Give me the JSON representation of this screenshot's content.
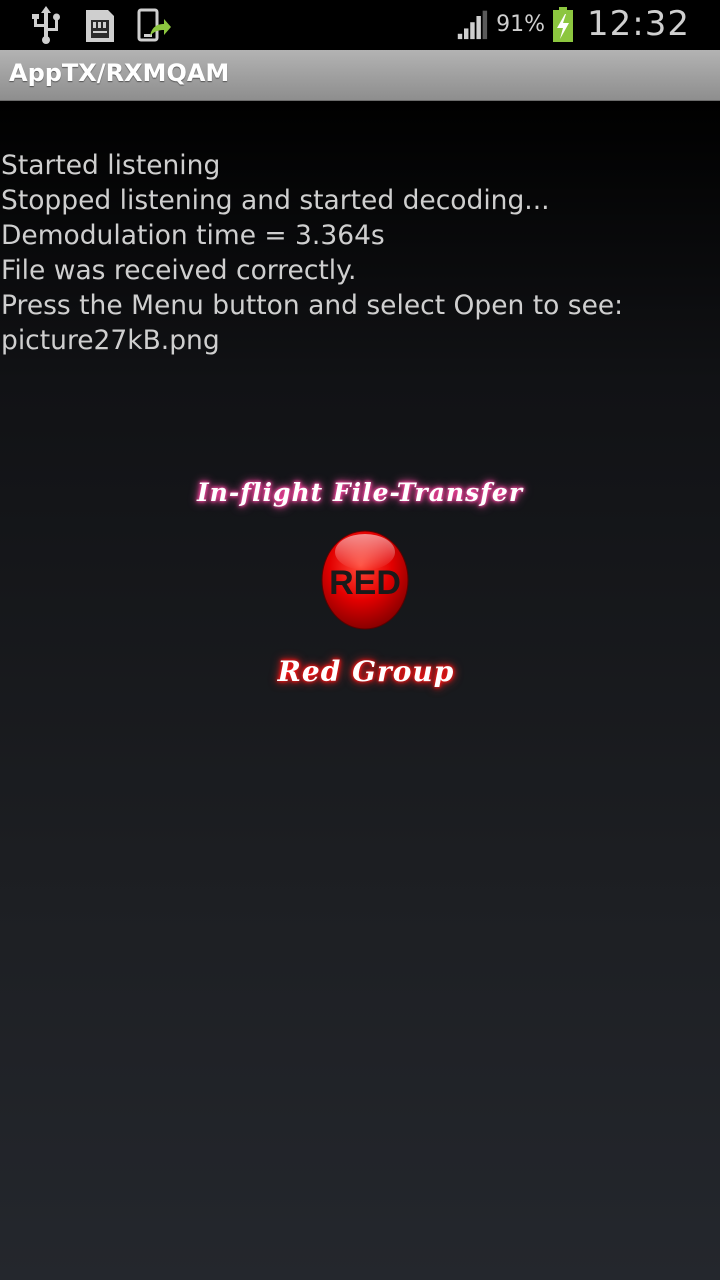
{
  "status_bar": {
    "battery_percent": "91%",
    "time": "12:32",
    "icons": [
      "usb-icon",
      "sd-card-icon",
      "screen-share-icon",
      "signal-icon",
      "battery-charging-icon"
    ],
    "colors": {
      "battery": "#8cc63f",
      "upload_arrow": "#8cc63f"
    }
  },
  "app": {
    "title": "AppTX/RXMQAM"
  },
  "log": {
    "lines": [
      "Started listening",
      "Stopped listening and started decoding...",
      "Demodulation time = 3.364s",
      "File was received correctly.",
      "Press the Menu button and select Open to see:",
      "picture27kB.png"
    ]
  },
  "branding": {
    "tagline": "In-flight File-Transfer",
    "button_label": "RED",
    "group_name": "Red Group",
    "colors": {
      "tagline_glow": "#ff3399",
      "group_glow": "#ff0000",
      "button": "#e30000"
    }
  }
}
